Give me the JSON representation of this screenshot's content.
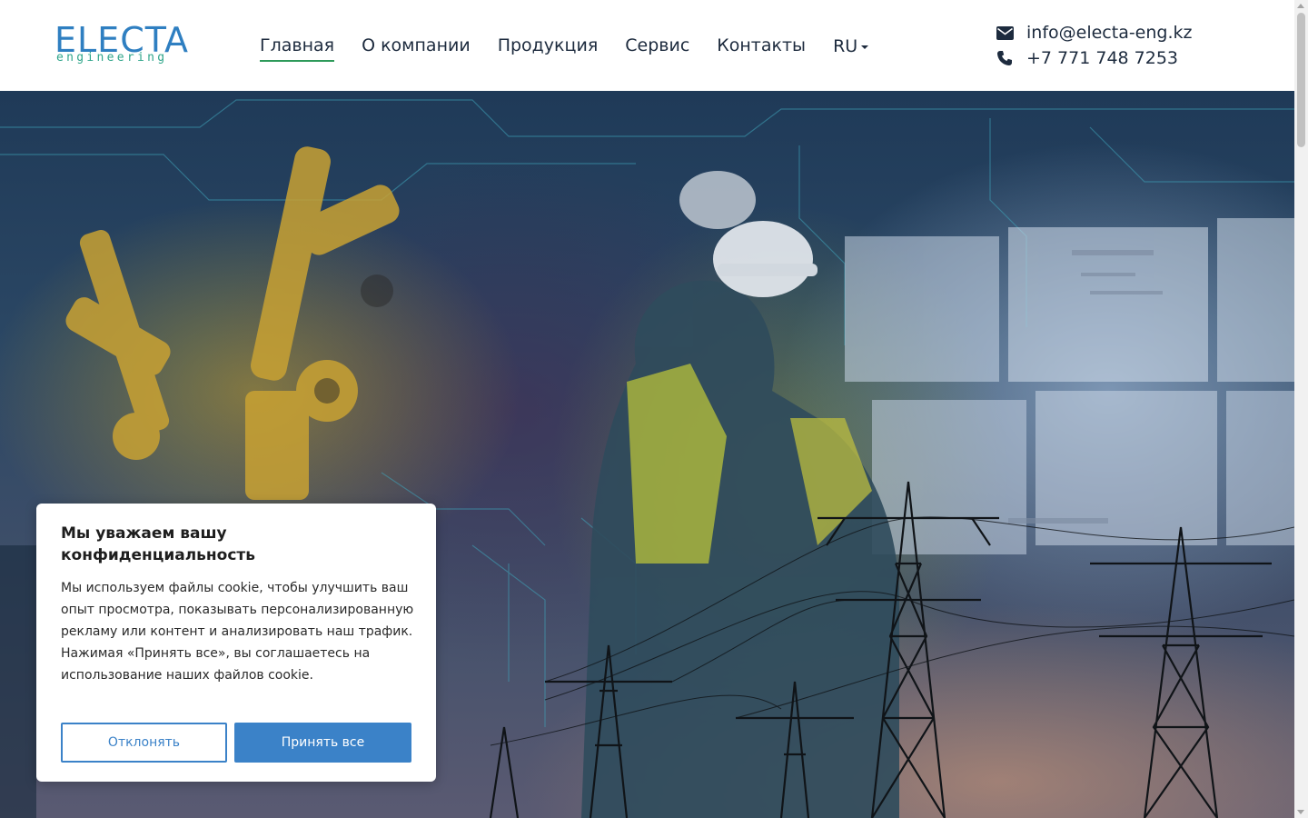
{
  "header": {
    "logo": {
      "main": "ELECTA",
      "sub": "engineering"
    },
    "nav": [
      {
        "label": "Главная",
        "active": true
      },
      {
        "label": "О компании"
      },
      {
        "label": "Продукция"
      },
      {
        "label": "Сервис"
      },
      {
        "label": "Контакты"
      }
    ],
    "language": "RU",
    "contacts": {
      "email": "info@electa-eng.kz",
      "phone": "+7 771 748 7253",
      "email_icon": "envelope-icon",
      "phone_icon": "phone-icon"
    }
  },
  "hero": {
    "image": "industrial-robots-engineers-power-lines-collage"
  },
  "cookie": {
    "title": "Мы уважаем вашу конфиденциальность",
    "body": "Мы используем файлы cookie, чтобы улучшить ваш опыт просмотра, показывать персонализированную рекламу или контент и анализировать наш трафик. Нажимая «Принять все», вы соглашаетесь на использование наших файлов cookie.",
    "reject_label": "Отклонять",
    "accept_label": "Принять все"
  },
  "colors": {
    "brand_blue": "#2f7fc1",
    "brand_green": "#2fa58a",
    "nav_active_underline": "#2e9a5a",
    "cookie_button": "#3b82c8"
  }
}
